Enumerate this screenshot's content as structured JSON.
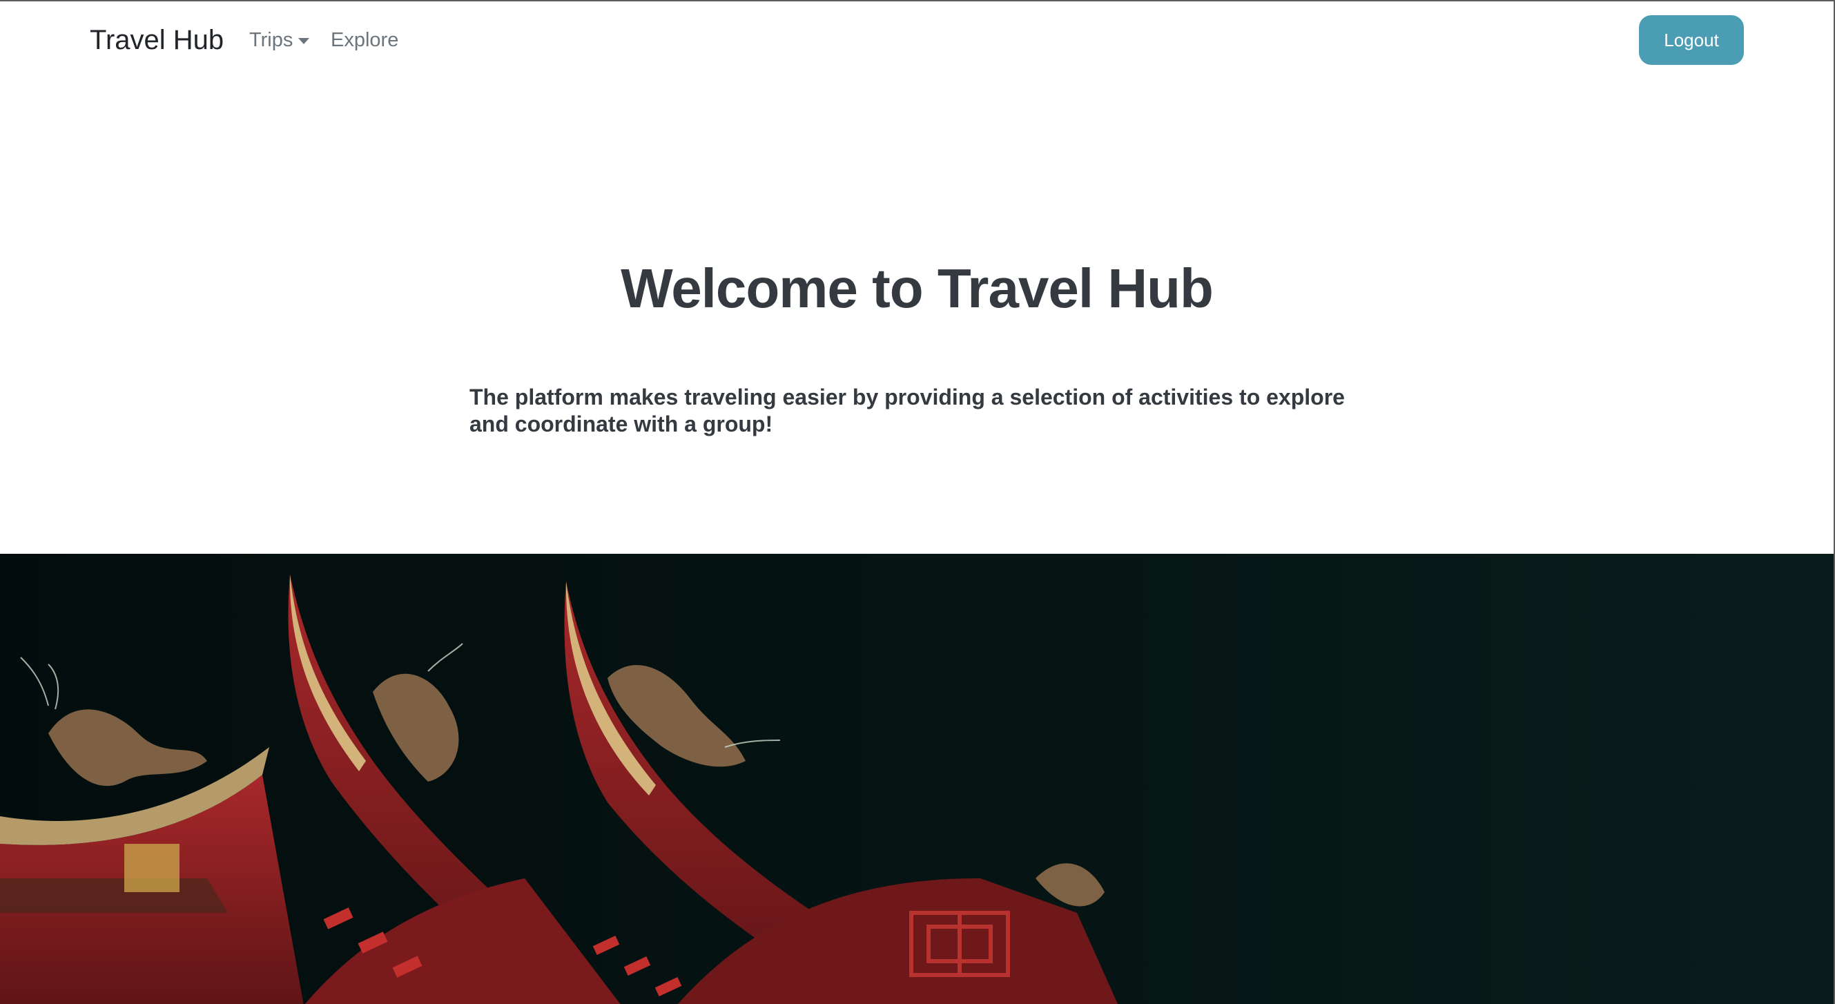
{
  "navbar": {
    "brand": "Travel Hub",
    "trips_label": "Trips",
    "explore_label": "Explore",
    "logout_label": "Logout",
    "logout_color": "#4a9db3"
  },
  "hero": {
    "title": "Welcome to Travel Hub",
    "subtitle": "The platform makes traveling easier by providing a selection of activities to explore and coordinate with a group!"
  },
  "colors": {
    "text_dark": "#343a40",
    "nav_text": "#6c757d",
    "photo_background": "#061514",
    "roof_red": "#8a1f22"
  }
}
